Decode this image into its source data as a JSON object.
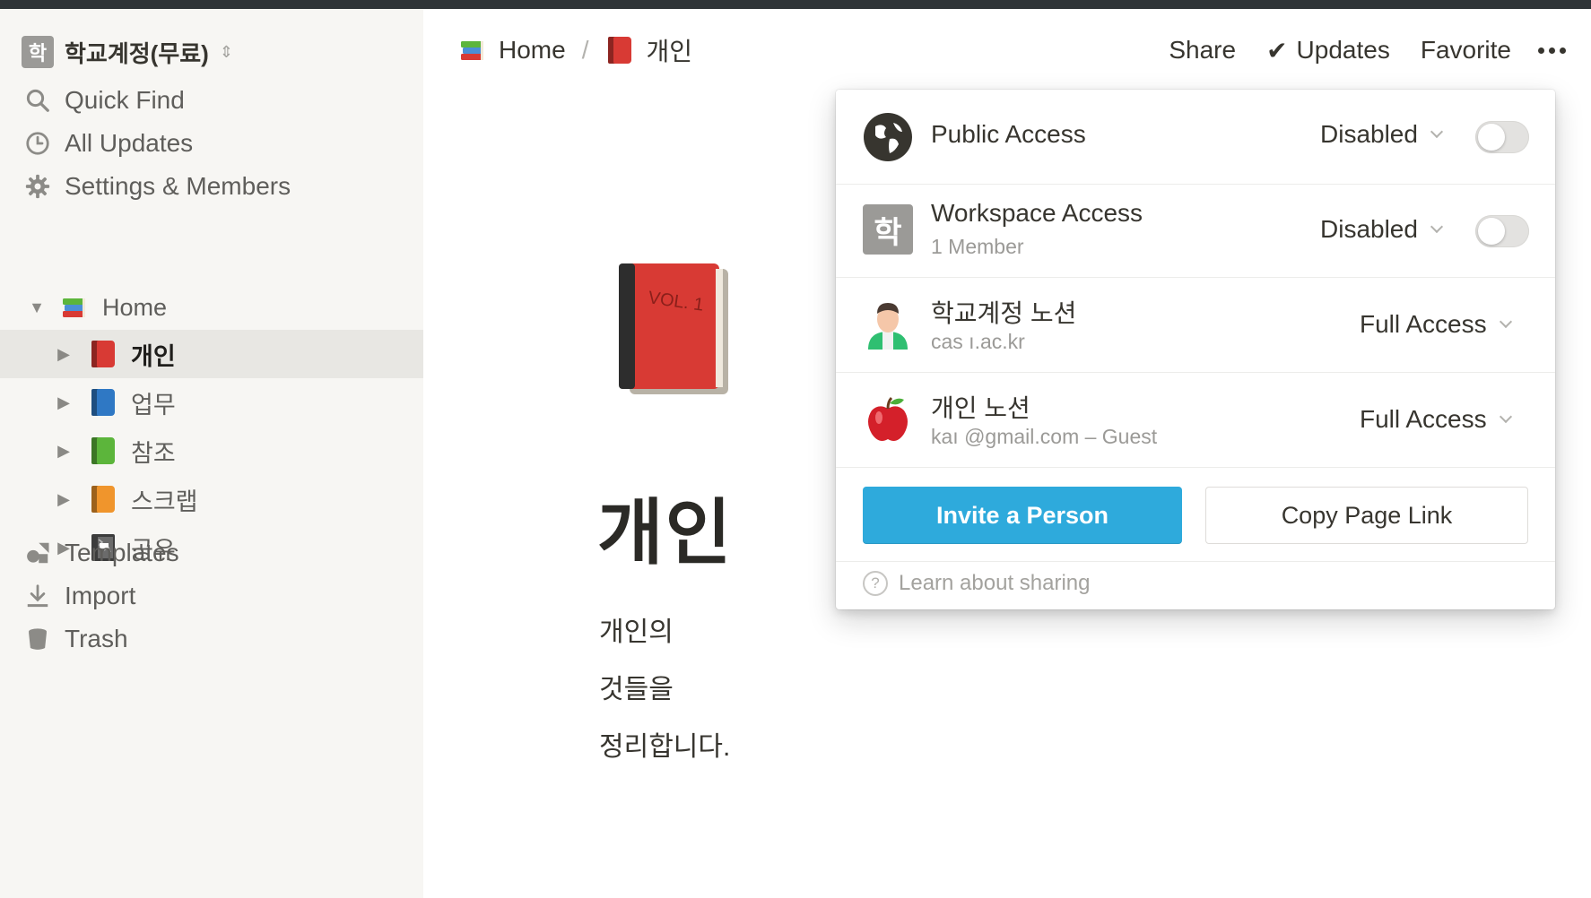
{
  "workspace": {
    "avatar_letter": "학",
    "name": "학교계정(무료)"
  },
  "sidebar": {
    "nav": [
      {
        "label": "Quick Find",
        "icon": "search-icon"
      },
      {
        "label": "All Updates",
        "icon": "clock-icon"
      },
      {
        "label": "Settings & Members",
        "icon": "gear-icon"
      }
    ],
    "tree_root": {
      "label": "Home",
      "icon": "books-icon"
    },
    "pages": [
      {
        "label": "개인",
        "icon": "red-book-icon",
        "color": "#d83a34",
        "active": true
      },
      {
        "label": "업무",
        "icon": "blue-book-icon",
        "color": "#2f78c4"
      },
      {
        "label": "참조",
        "icon": "green-book-icon",
        "color": "#5cb53b"
      },
      {
        "label": "스크랩",
        "icon": "orange-book-icon",
        "color": "#f0952c"
      },
      {
        "label": "공유",
        "icon": "notebook-icon",
        "color": "#4a4a4a"
      }
    ],
    "bottom": [
      {
        "label": "Templates",
        "icon": "shapes-icon"
      },
      {
        "label": "Import",
        "icon": "download-icon"
      },
      {
        "label": "Trash",
        "icon": "trash-icon"
      }
    ]
  },
  "header": {
    "breadcrumb": [
      {
        "label": "Home",
        "icon": "books-icon"
      },
      {
        "label": "개인",
        "icon": "red-book-icon"
      }
    ],
    "separator": "/",
    "actions": {
      "share": "Share",
      "updates": "Updates",
      "favorite": "Favorite"
    }
  },
  "page": {
    "icon": "red-book-icon",
    "icon_text": "VOL. 1",
    "title": "개인",
    "lines": [
      "개인의",
      "것들을",
      "정리합니다."
    ]
  },
  "share_popup": {
    "public_access": {
      "title": "Public Access",
      "status": "Disabled",
      "enabled": false
    },
    "workspace_access": {
      "avatar_letter": "학",
      "title": "Workspace Access",
      "subtitle": "1 Member",
      "status": "Disabled",
      "enabled": false
    },
    "members": [
      {
        "name": "학교계정 노션",
        "email": "cas                    ı.ac.kr",
        "access": "Full Access",
        "avatar": "person-avatar-icon"
      },
      {
        "name": "개인 노션",
        "email": "kaı                     @gmail.com – Guest",
        "access": "Full Access",
        "avatar": "apple-icon"
      }
    ],
    "invite_label": "Invite a Person",
    "copy_link_label": "Copy Page Link",
    "learn_label": "Learn about sharing",
    "colors": {
      "primary": "#2eaadc"
    }
  }
}
